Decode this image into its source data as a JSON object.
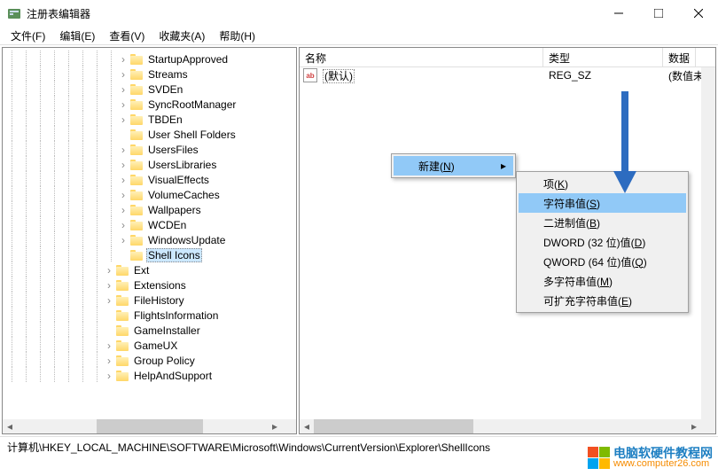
{
  "window": {
    "title": "注册表编辑器"
  },
  "menu": {
    "file": "文件(F)",
    "edit": "编辑(E)",
    "view": "查看(V)",
    "favorites": "收藏夹(A)",
    "help": "帮助(H)"
  },
  "tree": {
    "items": [
      {
        "label": "StartupApproved",
        "depth": 8,
        "exp": ">"
      },
      {
        "label": "Streams",
        "depth": 8,
        "exp": ">"
      },
      {
        "label": "SVDEn",
        "depth": 8,
        "exp": ">"
      },
      {
        "label": "SyncRootManager",
        "depth": 8,
        "exp": ">"
      },
      {
        "label": "TBDEn",
        "depth": 8,
        "exp": ">"
      },
      {
        "label": "User Shell Folders",
        "depth": 8,
        "exp": ""
      },
      {
        "label": "UsersFiles",
        "depth": 8,
        "exp": ">"
      },
      {
        "label": "UsersLibraries",
        "depth": 8,
        "exp": ">"
      },
      {
        "label": "VisualEffects",
        "depth": 8,
        "exp": ">"
      },
      {
        "label": "VolumeCaches",
        "depth": 8,
        "exp": ">"
      },
      {
        "label": "Wallpapers",
        "depth": 8,
        "exp": ">"
      },
      {
        "label": "WCDEn",
        "depth": 8,
        "exp": ">"
      },
      {
        "label": "WindowsUpdate",
        "depth": 8,
        "exp": ">"
      },
      {
        "label": "Shell Icons",
        "depth": 8,
        "exp": "",
        "selected": true
      },
      {
        "label": "Ext",
        "depth": 7,
        "exp": ">"
      },
      {
        "label": "Extensions",
        "depth": 7,
        "exp": ">"
      },
      {
        "label": "FileHistory",
        "depth": 7,
        "exp": ">"
      },
      {
        "label": "FlightsInformation",
        "depth": 7,
        "exp": ""
      },
      {
        "label": "GameInstaller",
        "depth": 7,
        "exp": ""
      },
      {
        "label": "GameUX",
        "depth": 7,
        "exp": ">"
      },
      {
        "label": "Group Policy",
        "depth": 7,
        "exp": ">"
      },
      {
        "label": "HelpAndSupport",
        "depth": 7,
        "exp": ">"
      }
    ]
  },
  "list": {
    "cols": {
      "name": "名称",
      "type": "类型",
      "data": "数据"
    },
    "rows": [
      {
        "name": "(默认)",
        "type": "REG_SZ",
        "data": "(数值未"
      }
    ]
  },
  "context_parent": {
    "new": "新建"
  },
  "context_new": {
    "key": "项",
    "string": "字符串值",
    "binary": "二进制值",
    "dword": "DWORD (32 位)值",
    "qword": "QWORD (64 位)值",
    "multi": "多字符串值",
    "expand": "可扩充字符串值"
  },
  "mnemonics": {
    "new": "N",
    "key": "K",
    "string": "S",
    "binary": "B",
    "dword": "D",
    "qword": "Q",
    "multi": "M",
    "expand": "E"
  },
  "statusbar": "计算机\\HKEY_LOCAL_MACHINE\\SOFTWARE\\Microsoft\\Windows\\CurrentVersion\\Explorer\\ShellIcons",
  "watermark": {
    "line1": "电脑软硬件教程网",
    "line2": "www.computer26.com"
  }
}
